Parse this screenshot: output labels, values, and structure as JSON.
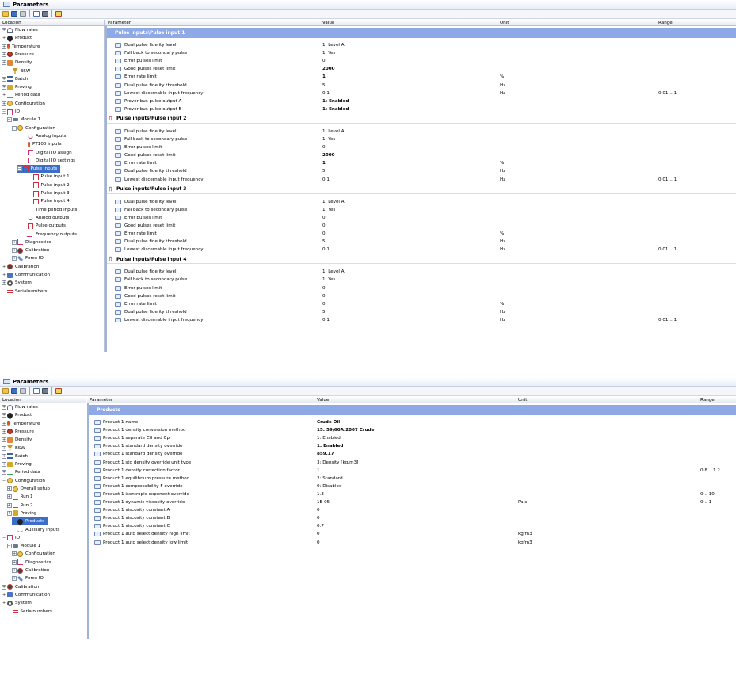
{
  "window_title": "Parameters",
  "panel1": {
    "headers": {
      "location": "Location",
      "parameter": "Parameter",
      "value": "Value",
      "unit": "Unit",
      "range": "Range"
    },
    "tree": [
      {
        "label": "Flow rates",
        "exp": "+",
        "ind": 0,
        "icon": "flow-rates-icon"
      },
      {
        "label": "Product",
        "exp": "+",
        "ind": 0,
        "icon": "product-drop-icon"
      },
      {
        "label": "Temperature",
        "exp": "+",
        "ind": 0,
        "icon": "thermometer-icon"
      },
      {
        "label": "Pressure",
        "exp": "+",
        "ind": 0,
        "icon": "pressure-gauge-icon"
      },
      {
        "label": "Density",
        "exp": "+",
        "ind": 0,
        "icon": "density-icon"
      },
      {
        "label": "BSW",
        "exp": "",
        "ind": 1,
        "icon": "funnel-icon"
      },
      {
        "label": "Batch",
        "exp": "+",
        "ind": 0,
        "icon": "batch-icon"
      },
      {
        "label": "Proving",
        "exp": "+",
        "ind": 0,
        "icon": "proving-icon"
      },
      {
        "label": "Period data",
        "exp": "+",
        "ind": 0,
        "icon": "period-data-icon"
      },
      {
        "label": "Configuration",
        "exp": "+",
        "ind": 0,
        "icon": "configuration-icon"
      },
      {
        "label": "IO",
        "exp": "-",
        "ind": 0,
        "icon": "io-icon"
      },
      {
        "label": "Module 1",
        "exp": "-",
        "ind": 1,
        "icon": "module-icon"
      },
      {
        "label": "Configuration",
        "exp": "-",
        "ind": 2,
        "icon": "configuration-icon"
      },
      {
        "label": "Analog inputs",
        "exp": "",
        "ind": 4,
        "icon": "analog-wave-icon"
      },
      {
        "label": "PT100 inputs",
        "exp": "",
        "ind": 4,
        "icon": "thermometer-icon"
      },
      {
        "label": "Digital IO assign",
        "exp": "",
        "ind": 4,
        "icon": "digital-io-icon"
      },
      {
        "label": "Digital IO settings",
        "exp": "",
        "ind": 4,
        "icon": "digital-io-icon"
      },
      {
        "label": "Pulse inputs",
        "exp": "-",
        "ind": 3,
        "icon": "pulse-icon",
        "selected": true
      },
      {
        "label": "Pulse input 1",
        "exp": "",
        "ind": 5,
        "icon": "pulse-icon"
      },
      {
        "label": "Pulse input 2",
        "exp": "",
        "ind": 5,
        "icon": "pulse-icon"
      },
      {
        "label": "Pulse input 3",
        "exp": "",
        "ind": 5,
        "icon": "pulse-icon"
      },
      {
        "label": "Pulse input 4",
        "exp": "",
        "ind": 5,
        "icon": "pulse-icon"
      },
      {
        "label": "Time period inputs",
        "exp": "",
        "ind": 4,
        "icon": "time-period-icon"
      },
      {
        "label": "Analog outputs",
        "exp": "",
        "ind": 4,
        "icon": "analog-wave-icon"
      },
      {
        "label": "Pulse outputs",
        "exp": "",
        "ind": 4,
        "icon": "pulse-icon"
      },
      {
        "label": "Frequency outputs",
        "exp": "",
        "ind": 4,
        "icon": "time-period-icon"
      },
      {
        "label": "Diagnostics",
        "exp": "+",
        "ind": 2,
        "icon": "diagnostics-icon"
      },
      {
        "label": "Calibration",
        "exp": "+",
        "ind": 2,
        "icon": "calibration-icon"
      },
      {
        "label": "Force IO",
        "exp": "+",
        "ind": 2,
        "icon": "wrench-icon"
      },
      {
        "label": "Calibration",
        "exp": "+",
        "ind": 0,
        "icon": "calibration-icon"
      },
      {
        "label": "Communication",
        "exp": "+",
        "ind": 0,
        "icon": "communication-icon"
      },
      {
        "label": "System",
        "exp": "+",
        "ind": 0,
        "icon": "system-gear-icon"
      },
      {
        "label": "Serialnumbers",
        "exp": "",
        "ind": 0,
        "icon": "serialnumbers-icon"
      }
    ],
    "sections": [
      {
        "title": "Pulse inputs\\Pulse input 1",
        "style": "blue",
        "rows": [
          {
            "param": "Dual pulse fidelity level",
            "value": "1: Level A",
            "unit": "",
            "range": ""
          },
          {
            "param": "Fall back to secondary pulse",
            "value": "1: Yes",
            "unit": "",
            "range": ""
          },
          {
            "param": "Error pulses limit",
            "value": "0",
            "unit": "",
            "range": ""
          },
          {
            "param": "Good pulses reset limit",
            "value": "2000",
            "unit": "",
            "range": "",
            "bold": true
          },
          {
            "param": "Error rate limit",
            "value": "1",
            "unit": "%",
            "range": "",
            "bold": true
          },
          {
            "param": "Dual pulse fidelity threshold",
            "value": "5",
            "unit": "Hz",
            "range": ""
          },
          {
            "param": "Lowest discernable input frequency",
            "value": "0.1",
            "unit": "Hz",
            "range": "0.01 .. 1"
          },
          {
            "param": "Prover bus pulse output A",
            "value": "1: Enabled",
            "unit": "",
            "range": "",
            "bold": true
          },
          {
            "param": "Prover bus pulse output B",
            "value": "1: Enabled",
            "unit": "",
            "range": "",
            "bold": true
          }
        ]
      },
      {
        "title": "Pulse inputs\\Pulse input 2",
        "style": "plain",
        "rows": [
          {
            "param": "Dual pulse fidelity level",
            "value": "1: Level A",
            "unit": "",
            "range": ""
          },
          {
            "param": "Fall back to secondary pulse",
            "value": "1: Yes",
            "unit": "",
            "range": ""
          },
          {
            "param": "Error pulses limit",
            "value": "0",
            "unit": "",
            "range": ""
          },
          {
            "param": "Good pulses reset limit",
            "value": "2000",
            "unit": "",
            "range": "",
            "bold": true
          },
          {
            "param": "Error rate limit",
            "value": "1",
            "unit": "%",
            "range": "",
            "bold": true
          },
          {
            "param": "Dual pulse fidelity threshold",
            "value": "5",
            "unit": "Hz",
            "range": ""
          },
          {
            "param": "Lowest discernable input frequency",
            "value": "0.1",
            "unit": "Hz",
            "range": "0.01 .. 1"
          }
        ]
      },
      {
        "title": "Pulse inputs\\Pulse input 3",
        "style": "plain",
        "rows": [
          {
            "param": "Dual pulse fidelity level",
            "value": "1: Level A",
            "unit": "",
            "range": ""
          },
          {
            "param": "Fall back to secondary pulse",
            "value": "1: Yes",
            "unit": "",
            "range": ""
          },
          {
            "param": "Error pulses limit",
            "value": "0",
            "unit": "",
            "range": ""
          },
          {
            "param": "Good pulses reset limit",
            "value": "0",
            "unit": "",
            "range": ""
          },
          {
            "param": "Error rate limit",
            "value": "0",
            "unit": "%",
            "range": ""
          },
          {
            "param": "Dual pulse fidelity threshold",
            "value": "5",
            "unit": "Hz",
            "range": ""
          },
          {
            "param": "Lowest discernable input frequency",
            "value": "0.1",
            "unit": "Hz",
            "range": "0.01 .. 1"
          }
        ]
      },
      {
        "title": "Pulse inputs\\Pulse input 4",
        "style": "plain",
        "rows": [
          {
            "param": "Dual pulse fidelity level",
            "value": "1: Level A",
            "unit": "",
            "range": ""
          },
          {
            "param": "Fall back to secondary pulse",
            "value": "1: Yes",
            "unit": "",
            "range": ""
          },
          {
            "param": "Error pulses limit",
            "value": "0",
            "unit": "",
            "range": ""
          },
          {
            "param": "Good pulses reset limit",
            "value": "0",
            "unit": "",
            "range": ""
          },
          {
            "param": "Error rate limit",
            "value": "0",
            "unit": "%",
            "range": ""
          },
          {
            "param": "Dual pulse fidelity threshold",
            "value": "5",
            "unit": "Hz",
            "range": ""
          },
          {
            "param": "Lowest discernable input frequency",
            "value": "0.1",
            "unit": "Hz",
            "range": "0.01 .. 1"
          }
        ]
      }
    ]
  },
  "panel2": {
    "headers": {
      "location": "Location",
      "parameter": "Parameter",
      "value": "Value",
      "unit": "Unit",
      "range": "Range"
    },
    "tree": [
      {
        "label": "Flow rates",
        "exp": "+",
        "ind": 0,
        "icon": "flow-rates-icon"
      },
      {
        "label": "Product",
        "exp": "+",
        "ind": 0,
        "icon": "product-drop-icon"
      },
      {
        "label": "Temperature",
        "exp": "+",
        "ind": 0,
        "icon": "thermometer-icon"
      },
      {
        "label": "Pressure",
        "exp": "+",
        "ind": 0,
        "icon": "pressure-gauge-icon"
      },
      {
        "label": "Density",
        "exp": "+",
        "ind": 0,
        "icon": "density-icon"
      },
      {
        "label": "BSW",
        "exp": "+",
        "ind": 0,
        "icon": "funnel-icon"
      },
      {
        "label": "Batch",
        "exp": "+",
        "ind": 0,
        "icon": "batch-icon"
      },
      {
        "label": "Proving",
        "exp": "+",
        "ind": 0,
        "icon": "proving-icon"
      },
      {
        "label": "Period data",
        "exp": "+",
        "ind": 0,
        "icon": "period-data-icon"
      },
      {
        "label": "Configuration",
        "exp": "-",
        "ind": 0,
        "icon": "configuration-icon"
      },
      {
        "label": "Overall setup",
        "exp": "+",
        "ind": 1,
        "icon": "configuration-icon"
      },
      {
        "label": "Run 1",
        "exp": "+",
        "ind": 1,
        "icon": "run-icon"
      },
      {
        "label": "Run 2",
        "exp": "+",
        "ind": 1,
        "icon": "run-icon"
      },
      {
        "label": "Proving",
        "exp": "+",
        "ind": 1,
        "icon": "proving-icon"
      },
      {
        "label": "Products",
        "exp": "",
        "ind": 2,
        "icon": "product-drop-icon",
        "selected": true
      },
      {
        "label": "Auxiliary inputs",
        "exp": "",
        "ind": 2,
        "icon": "analog-wave-icon"
      },
      {
        "label": "IO",
        "exp": "-",
        "ind": 0,
        "icon": "io-icon"
      },
      {
        "label": "Module 1",
        "exp": "-",
        "ind": 1,
        "icon": "module-icon"
      },
      {
        "label": "Configuration",
        "exp": "+",
        "ind": 2,
        "icon": "configuration-icon"
      },
      {
        "label": "Diagnostics",
        "exp": "+",
        "ind": 2,
        "icon": "diagnostics-icon"
      },
      {
        "label": "Calibration",
        "exp": "+",
        "ind": 2,
        "icon": "calibration-icon"
      },
      {
        "label": "Force IO",
        "exp": "+",
        "ind": 2,
        "icon": "wrench-icon"
      },
      {
        "label": "Calibration",
        "exp": "+",
        "ind": 0,
        "icon": "calibration-icon"
      },
      {
        "label": "Communication",
        "exp": "+",
        "ind": 0,
        "icon": "communication-icon"
      },
      {
        "label": "System",
        "exp": "+",
        "ind": 0,
        "icon": "system-gear-icon"
      },
      {
        "label": "Serialnumbers",
        "exp": "",
        "ind": 1,
        "icon": "serialnumbers-icon"
      }
    ],
    "sections": [
      {
        "title": "Products",
        "style": "blue",
        "rows": [
          {
            "param": "Product 1 name",
            "value": "Crude Oil",
            "unit": "",
            "range": "",
            "bold": true
          },
          {
            "param": "Product 1 density conversion method",
            "value": "15: 59/60A:2007 Crude",
            "unit": "",
            "range": "",
            "bold": true
          },
          {
            "param": "Product 1 separate Ctl and Cpl",
            "value": "1: Enabled",
            "unit": "",
            "range": ""
          },
          {
            "param": "Product 1 standard density override",
            "value": "1: Enabled",
            "unit": "",
            "range": "",
            "bold": true
          },
          {
            "param": "Product 1 standard density override",
            "value": "859.17",
            "unit": "",
            "range": "",
            "bold": true
          },
          {
            "param": "Product 1 std density override unit type",
            "value": "3: Density [kg/m3]",
            "unit": "",
            "range": ""
          },
          {
            "param": "Product 1 density correction factor",
            "value": "1",
            "unit": "",
            "range": "0.8 .. 1.2"
          },
          {
            "param": "Product 1 equilibrium pressure method",
            "value": "2: Standard",
            "unit": "",
            "range": ""
          },
          {
            "param": "Product 1 compressibility F override",
            "value": "0: Disabled",
            "unit": "",
            "range": ""
          },
          {
            "param": "Product 1 isentropic exponent override",
            "value": "1.3",
            "unit": "",
            "range": "0 .. 10"
          },
          {
            "param": "Product 1 dynamic viscosity override",
            "value": "1E-05",
            "unit": "Pa.s",
            "range": "0 .. 1"
          },
          {
            "param": "Product 1 viscosity constant A",
            "value": "0",
            "unit": "",
            "range": ""
          },
          {
            "param": "Product 1 viscosity constant B",
            "value": "0",
            "unit": "",
            "range": ""
          },
          {
            "param": "Product 1 viscosity constant C",
            "value": "0.7",
            "unit": "",
            "range": ""
          },
          {
            "param": "Product 1 auto select density high limit",
            "value": "0",
            "unit": "kg/m3",
            "range": ""
          },
          {
            "param": "Product 1 auto select density low limit",
            "value": "0",
            "unit": "kg/m3",
            "range": ""
          }
        ]
      }
    ]
  },
  "colors": {
    "section_header": "#8fa9e6",
    "selection": "#3a6ec8",
    "pulse_icon": "#d0303a"
  }
}
